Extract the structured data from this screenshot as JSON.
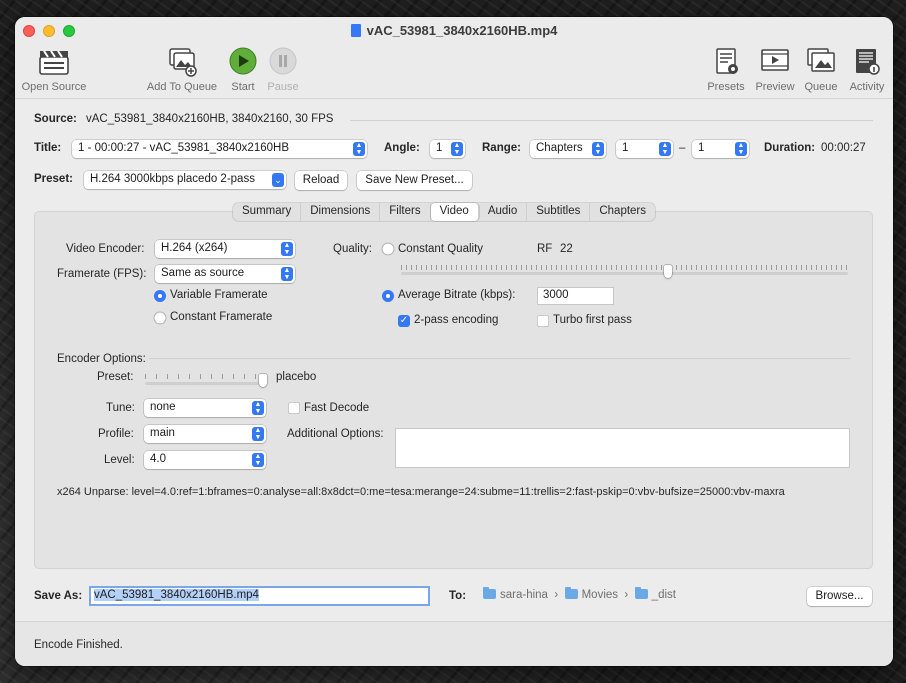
{
  "window": {
    "title": "vAC_53981_3840x2160HB.mp4"
  },
  "toolbar": {
    "open_source": "Open Source",
    "add_to_queue": "Add To Queue",
    "start": "Start",
    "pause": "Pause",
    "presets": "Presets",
    "preview": "Preview",
    "queue": "Queue",
    "activity": "Activity"
  },
  "source": {
    "label": "Source:",
    "value": "vAC_53981_3840x2160HB, 3840x2160, 30 FPS"
  },
  "title_row": {
    "title_label": "Title:",
    "title_value": "1 - 00:00:27 - vAC_53981_3840x2160HB",
    "angle_label": "Angle:",
    "angle_value": "1",
    "range_label": "Range:",
    "range_value": "Chapters",
    "range_start": "1",
    "range_dash": "–",
    "range_end": "1",
    "duration_label": "Duration:",
    "duration_value": "00:00:27"
  },
  "preset_row": {
    "label": "Preset:",
    "value": "H.264 3000kbps placedo 2-pass",
    "reload": "Reload",
    "save_new": "Save New Preset..."
  },
  "tabs": [
    "Summary",
    "Dimensions",
    "Filters",
    "Video",
    "Audio",
    "Subtitles",
    "Chapters"
  ],
  "active_tab": "Video",
  "video": {
    "encoder_label": "Video Encoder:",
    "encoder_value": "H.264 (x264)",
    "framerate_label": "Framerate (FPS):",
    "framerate_value": "Same as source",
    "variable_framerate": "Variable Framerate",
    "constant_framerate": "Constant Framerate",
    "quality_label": "Quality:",
    "constant_quality": "Constant Quality",
    "rf_label": "RF",
    "rf_value": "22",
    "quality_slider_level": 0.6,
    "average_bitrate": "Average Bitrate (kbps):",
    "bitrate_value": "3000",
    "two_pass": "2-pass encoding",
    "turbo_first_pass": "Turbo first pass",
    "encoder_options": "Encoder Options:",
    "preset_label": "Preset:",
    "preset_value": "placebo",
    "preset_slider_level": 1.0,
    "tune_label": "Tune:",
    "tune_value": "none",
    "fast_decode": "Fast Decode",
    "profile_label": "Profile:",
    "profile_value": "main",
    "additional_options": "Additional Options:",
    "level_label": "Level:",
    "level_value": "4.0",
    "unparse": "x264 Unparse: level=4.0:ref=1:bframes=0:analyse=all:8x8dct=0:me=tesa:merange=24:subme=11:trellis=2:fast-pskip=0:vbv-bufsize=25000:vbv-maxra"
  },
  "save": {
    "label": "Save As:",
    "value": "vAC_53981_3840x2160HB.mp4",
    "to_label": "To:",
    "path": [
      "sara-hina",
      "Movies",
      "_dist"
    ],
    "browse": "Browse..."
  },
  "status": "Encode Finished."
}
